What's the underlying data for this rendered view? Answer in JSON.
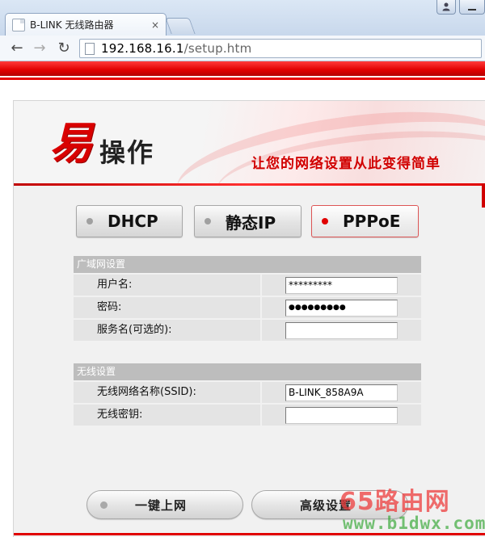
{
  "browser": {
    "tab_title": "B-LINK 无线路由器",
    "tab_close": "×",
    "url_host": "192.168.16.1",
    "url_path": "/setup.htm",
    "back": "←",
    "forward": "→",
    "reload": "↻",
    "win_user": "👤",
    "win_min": "—"
  },
  "banner": {
    "brand_big": "易",
    "brand_small": "操作",
    "slogan": "让您的网络设置从此变得简单"
  },
  "modes": [
    {
      "label": "DHCP",
      "active": false
    },
    {
      "label": "静态IP",
      "active": false
    },
    {
      "label": "PPPoE",
      "active": true
    }
  ],
  "wan": {
    "title": "广域网设置",
    "username_label": "用户名:",
    "username_value": "*********",
    "password_label": "密码:",
    "password_value": "●●●●●●●●●",
    "service_label": "服务名(可选的):",
    "service_value": ""
  },
  "wireless": {
    "title": "无线设置",
    "ssid_label": "无线网络名称(SSID):",
    "ssid_value": "B-LINK_858A9A",
    "key_label": "无线密钥:",
    "key_value": ""
  },
  "actions": {
    "connect_label": "一键上网",
    "advanced_label": "高级设置"
  },
  "watermark": {
    "line1": "65路由网",
    "line2": "www.b1dwx.com"
  }
}
